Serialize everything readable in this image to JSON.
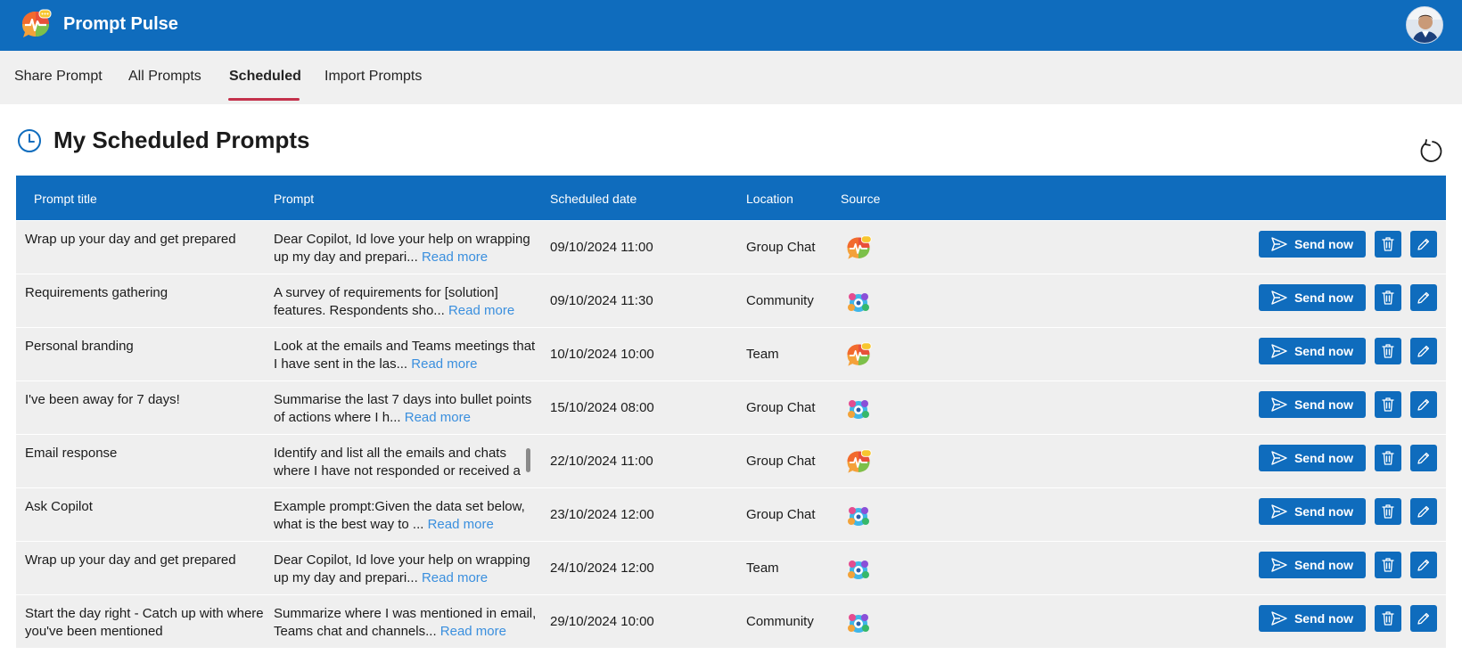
{
  "app": {
    "title": "Prompt Pulse"
  },
  "tabs": [
    {
      "label": "Share Prompt"
    },
    {
      "label": "All Prompts"
    },
    {
      "label": "Scheduled"
    },
    {
      "label": "Import Prompts"
    }
  ],
  "page": {
    "title": "My Scheduled Prompts"
  },
  "table": {
    "headers": {
      "title": "Prompt title",
      "prompt": "Prompt",
      "date": "Scheduled date",
      "location": "Location",
      "source": "Source"
    },
    "actions": {
      "send_label": "Send now",
      "read_more": "Read more"
    },
    "rows": [
      {
        "title": "Wrap up your day and get prepared",
        "prompt": "Dear Copilot, Id love your help on wrapping up my day and prepari...",
        "date": "09/10/2024 11:00",
        "location": "Group Chat",
        "source": "pulse-icon"
      },
      {
        "title": "Requirements gathering",
        "prompt": "A survey of requirements for [solution] features. Respondents sho...",
        "date": "09/10/2024 11:30",
        "location": "Community",
        "source": "community-icon"
      },
      {
        "title": "Personal branding",
        "prompt": "Look at the emails and Teams meetings that I have sent in the las...",
        "date": "10/10/2024 10:00",
        "location": "Team",
        "source": "pulse-icon"
      },
      {
        "title": "I've been away for 7 days!",
        "prompt": "Summarise the last 7 days into bullet points of actions where I h...",
        "date": "15/10/2024 08:00",
        "location": "Group Chat",
        "source": "community-icon"
      },
      {
        "title": "Email response",
        "prompt": "Identify and list all the emails and chats where I have not responded or received a",
        "date": "22/10/2024 11:00",
        "location": "Group Chat",
        "source": "pulse-icon"
      },
      {
        "title": "Ask Copilot",
        "prompt": "Example prompt:Given the data set below, what is the best way to ...",
        "date": "23/10/2024 12:00",
        "location": "Group Chat",
        "source": "community-icon"
      },
      {
        "title": "Wrap up your day and get prepared",
        "prompt": "Dear Copilot, Id love your help on wrapping up my day and prepari...",
        "date": "24/10/2024 12:00",
        "location": "Team",
        "source": "community-icon"
      },
      {
        "title": "Start the day right - Catch up with where you've been mentioned",
        "prompt": "Summarize where I was mentioned in email, Teams chat and channels...",
        "date": "29/10/2024 10:00",
        "location": "Community",
        "source": "community-icon"
      }
    ]
  },
  "colors": {
    "brand": "#0f6cbd",
    "tab_indicator": "#c4314b",
    "link": "#3a8fde",
    "row_bg": "#efefef"
  }
}
